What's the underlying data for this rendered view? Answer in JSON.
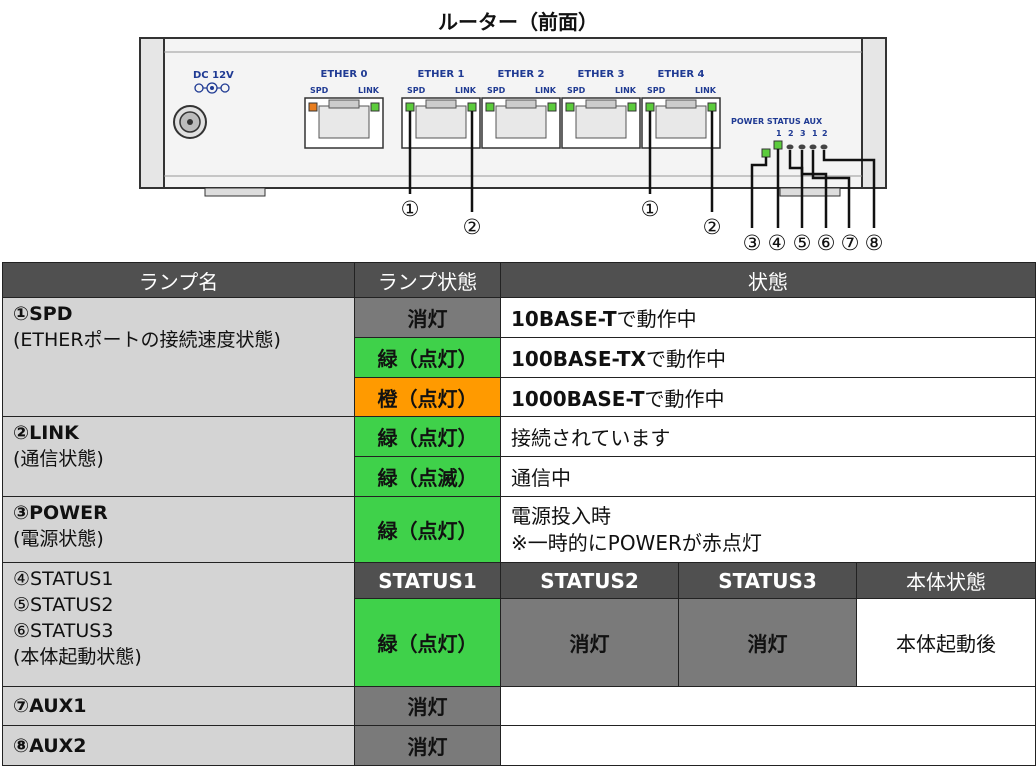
{
  "title": "ルーター（前面）",
  "router": {
    "dc_label": "DC 12V",
    "ports": [
      {
        "name": "ETHER 0",
        "spd": "SPD",
        "link": "LINK"
      },
      {
        "name": "ETHER 1",
        "spd": "SPD",
        "link": "LINK"
      },
      {
        "name": "ETHER 2",
        "spd": "SPD",
        "link": "LINK"
      },
      {
        "name": "ETHER 3",
        "spd": "SPD",
        "link": "LINK"
      },
      {
        "name": "ETHER 4",
        "spd": "SPD",
        "link": "LINK"
      }
    ],
    "led_header": "POWER  STATUS AUX",
    "led_numbers": [
      "1",
      "2",
      "3",
      "1",
      "2"
    ],
    "callouts": [
      "①",
      "②",
      "①",
      "②",
      "③",
      "④",
      "⑤",
      "⑥",
      "⑦",
      "⑧"
    ],
    "colors": {
      "led_green": "#5ccc3c",
      "led_orange": "#e87d1e",
      "label_blue": "#1f3a93"
    }
  },
  "table": {
    "headers": [
      "ランプ名",
      "ランプ状態",
      "状態"
    ],
    "rows": {
      "spd": {
        "name": "①SPD",
        "sub": "(ETHERポートの接続速度状態)",
        "states": [
          {
            "lamp": "消灯",
            "desc_bold": "10BASE-T",
            "desc": "で動作中"
          },
          {
            "lamp": "緑（点灯）",
            "desc_bold": "100BASE-TX",
            "desc": "で動作中"
          },
          {
            "lamp": "橙（点灯）",
            "desc_bold": "1000BASE-T",
            "desc": "で動作中"
          }
        ]
      },
      "link": {
        "name": "②LINK",
        "sub": "(通信状態)",
        "states": [
          {
            "lamp": "緑（点灯）",
            "desc": "接続されています"
          },
          {
            "lamp": "緑（点滅）",
            "desc": "通信中"
          }
        ]
      },
      "power": {
        "name": "③POWER",
        "sub": "(電源状態)",
        "lamp": "緑（点灯）",
        "desc1": "電源投入時",
        "desc2": "※一時的にPOWERが赤点灯"
      },
      "status": {
        "name1": "④STATUS1",
        "name2": "⑤STATUS2",
        "name3": "⑥STATUS3",
        "sub": "(本体起動状態)",
        "headers": [
          "STATUS1",
          "STATUS2",
          "STATUS3",
          "本体状態"
        ],
        "values": [
          "緑（点灯）",
          "消灯",
          "消灯",
          "本体起動後"
        ]
      },
      "aux1": {
        "name": "⑦AUX1",
        "lamp": "消灯"
      },
      "aux2": {
        "name": "⑧AUX2",
        "lamp": "消灯"
      }
    }
  }
}
